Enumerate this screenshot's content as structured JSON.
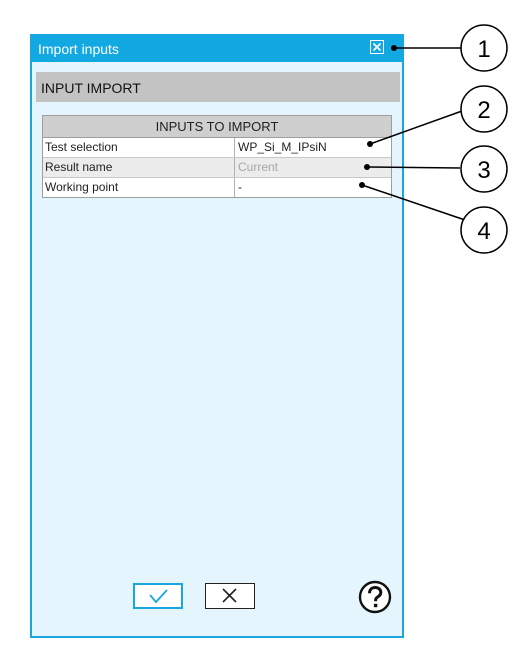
{
  "window": {
    "title": "Import inputs"
  },
  "section": {
    "title": "INPUT IMPORT"
  },
  "table": {
    "header": "INPUTS TO IMPORT",
    "rows": [
      {
        "label": "Test selection",
        "value": "WP_Si_M_IPsiN"
      },
      {
        "label": "Result name",
        "value": "Current"
      },
      {
        "label": "Working point",
        "value": "-"
      }
    ]
  },
  "callouts": [
    "1",
    "2",
    "3",
    "4"
  ],
  "icons": {
    "close": "close-icon",
    "ok": "check-icon",
    "cancel": "x-icon",
    "help": "help-icon"
  },
  "colors": {
    "accent": "#12a8e2",
    "dialog_bg": "#e5f5fd",
    "section_bg": "#c3c3c3"
  }
}
